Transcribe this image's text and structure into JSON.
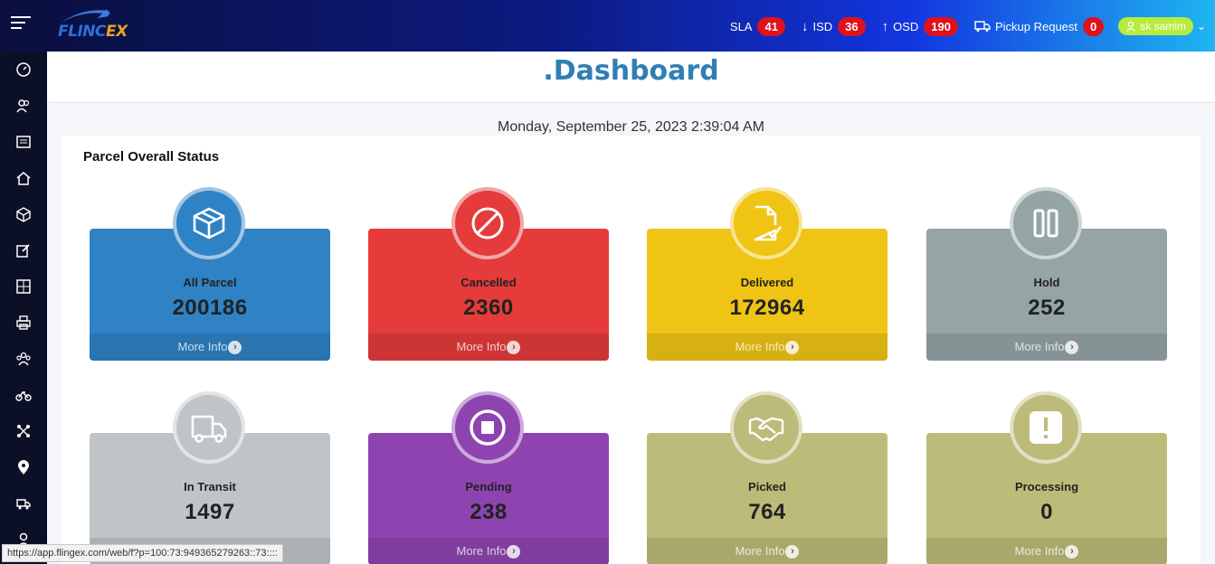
{
  "topbar": {
    "logo": {
      "part1": "FLINC",
      "part2": "EX"
    },
    "sla": {
      "label": "SLA",
      "count": "41"
    },
    "isd": {
      "label": "ISD",
      "count": "36"
    },
    "osd": {
      "label": "OSD",
      "count": "190"
    },
    "pickup": {
      "label": "Pickup Request",
      "count": "0"
    },
    "user": {
      "name": "sk samim"
    }
  },
  "page": {
    "title": ".Dashboard",
    "datetime": "Monday, September 25, 2023 2:39:04 AM",
    "section_title": "Parcel Overall Status",
    "more_info": "More Info"
  },
  "cards": [
    {
      "label": "All Parcel",
      "count": "200186",
      "color": "#2f82c4",
      "icon": "box-icon"
    },
    {
      "label": "Cancelled",
      "count": "2360",
      "color": "#e53b3b",
      "icon": "ban-icon"
    },
    {
      "label": "Delivered",
      "count": "172964",
      "color": "#f0c414",
      "icon": "file-check-icon"
    },
    {
      "label": "Hold",
      "count": "252",
      "color": "#95a4a5",
      "icon": "pause-icon"
    },
    {
      "label": "In Transit",
      "count": "1497",
      "color": "#bfc4c8",
      "icon": "truck-icon"
    },
    {
      "label": "Pending",
      "count": "238",
      "color": "#8e44b0",
      "icon": "stop-icon"
    },
    {
      "label": "Picked",
      "count": "764",
      "color": "#bdbb79",
      "icon": "handshake-icon"
    },
    {
      "label": "Processing",
      "count": "0",
      "color": "#bdbb79",
      "icon": "exclamation-icon"
    }
  ],
  "sidebar": {
    "icons": [
      "dashboard-icon",
      "users-icon",
      "list-icon",
      "home-icon",
      "cube-icon",
      "edit-icon",
      "warehouse-icon",
      "print-icon",
      "team-icon",
      "bicycle-icon",
      "network-icon",
      "location-icon",
      "truck-small-icon",
      "user-icon"
    ]
  },
  "statusbar": {
    "url": "https://app.flingex.com/web/f?p=100:73:949365279263::73::::"
  }
}
